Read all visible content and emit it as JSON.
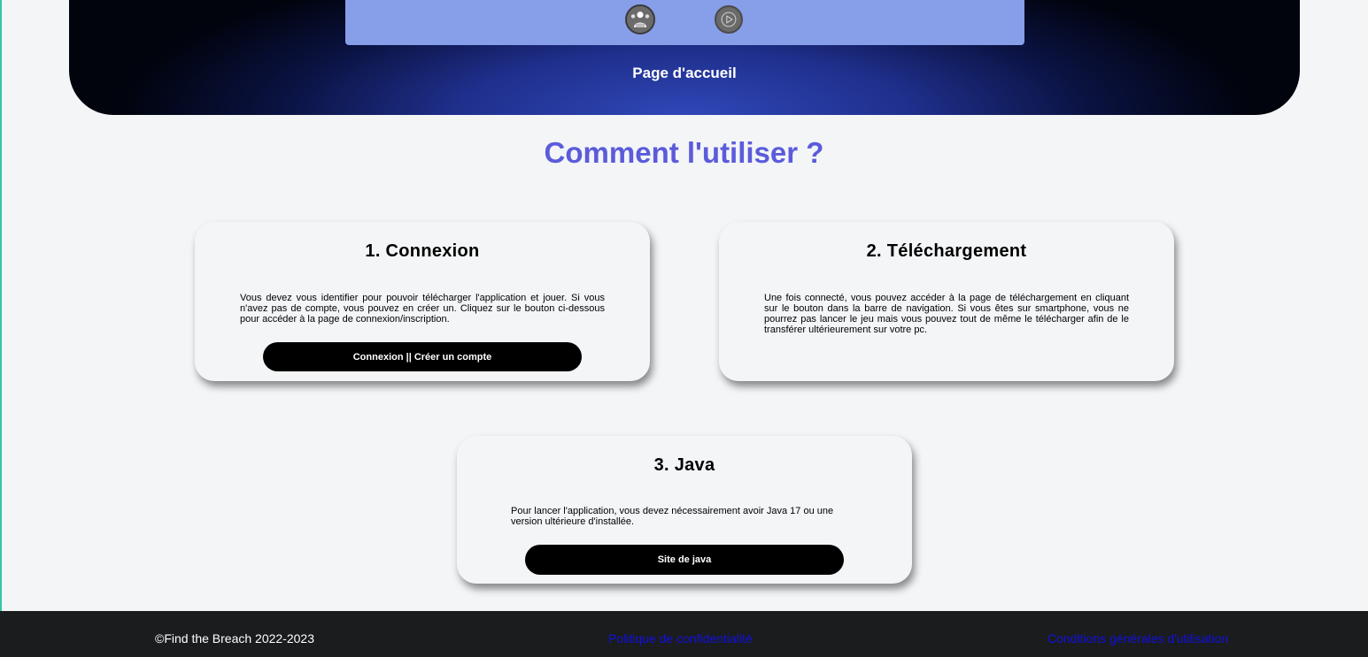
{
  "hero": {
    "label": "Page d'accueil",
    "icons": [
      "logo-icon",
      "play-icon"
    ]
  },
  "section": {
    "title": "Comment l'utiliser ?"
  },
  "cards": [
    {
      "title": "1. Connexion",
      "text": "Vous devez vous identifier pour pouvoir télécharger l'application et jouer. Si vous n'avez pas de compte, vous pouvez en créer un. Cliquez sur le bouton ci-dessous pour accéder à la page de connexion/inscription.",
      "button": "Connexion || Créer un compte"
    },
    {
      "title": "2. Téléchargement",
      "text": "Une fois connecté, vous pouvez accéder à la page de téléchargement en cliquant sur le bouton dans la barre de navigation. Si vous êtes sur smartphone, vous ne pourrez pas lancer le jeu mais vous pouvez tout de même le télécharger afin de le transférer ultérieurement sur votre pc."
    },
    {
      "title": "3. Java",
      "text": "Pour lancer l'application, vous devez nécessairement avoir Java 17 ou une version ultérieure d'installée.",
      "button": "Site de java"
    }
  ],
  "footer": {
    "copyright": "©Find the Breach 2022-2023",
    "privacy": "Politique de confidentialité",
    "terms": "Conditions générales d'utilisation"
  },
  "colors": {
    "title": "#5b5bdb",
    "hero_panel": "#879ee9",
    "footer_bg": "#1b1c1e",
    "footer_link": "#1010e0"
  }
}
